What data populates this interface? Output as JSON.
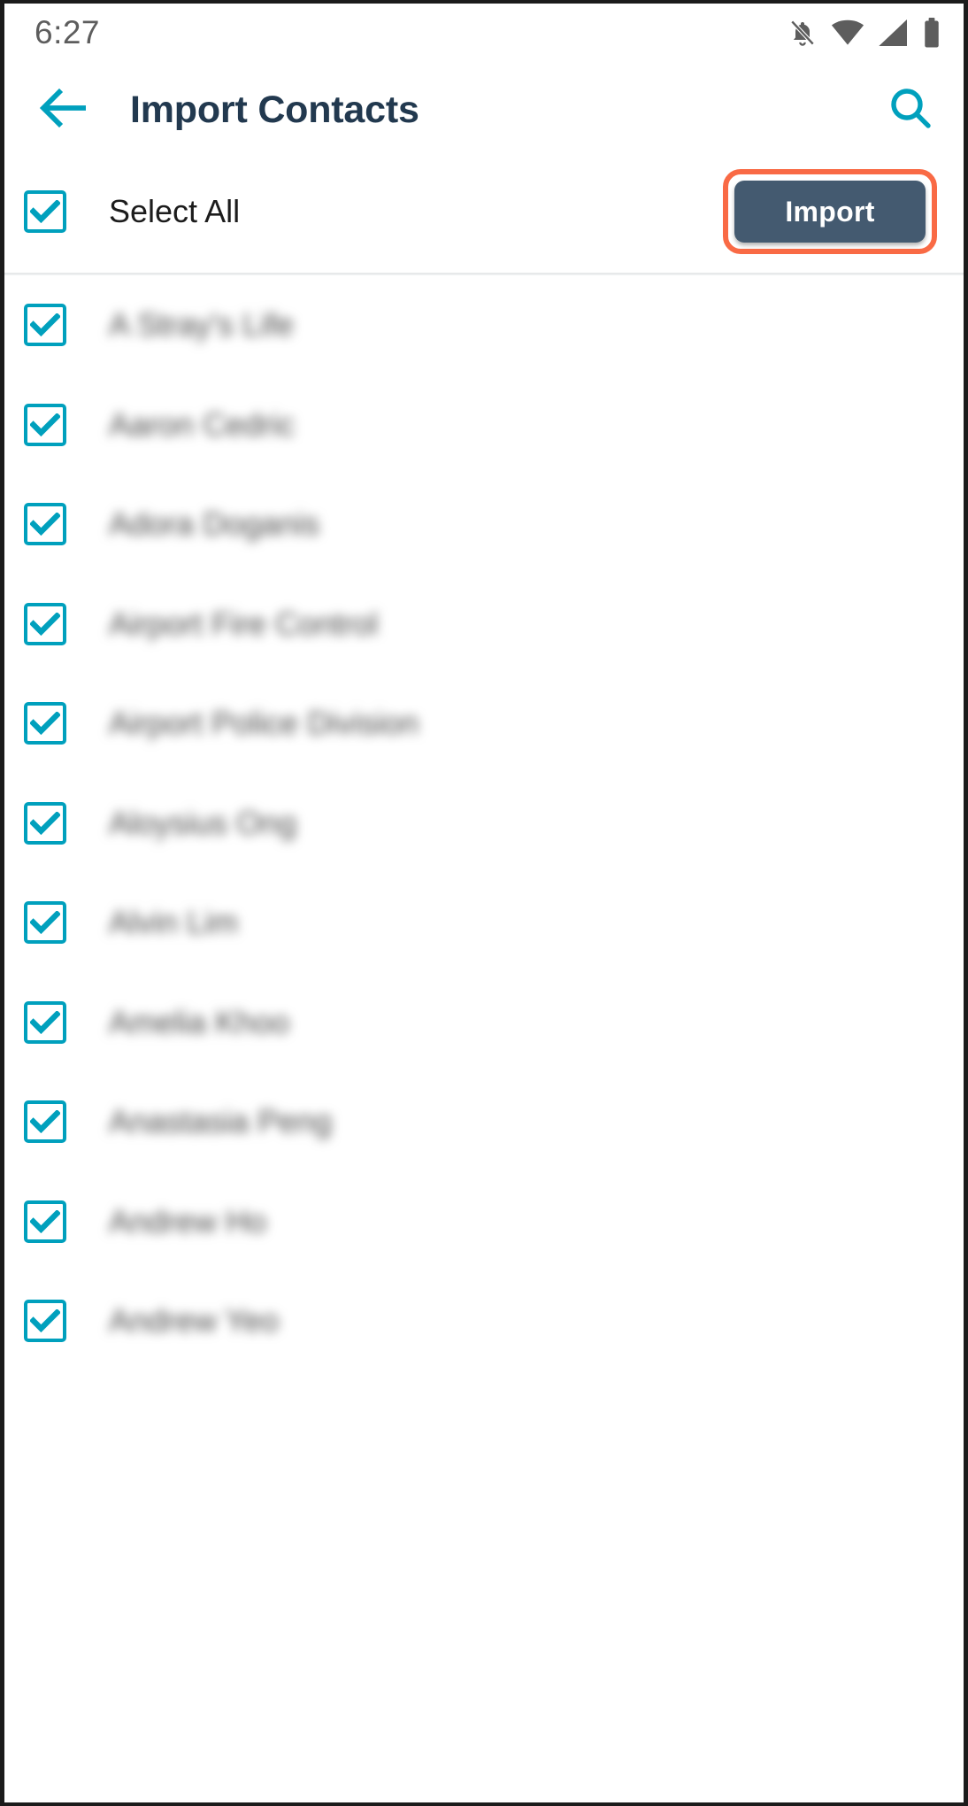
{
  "status_bar": {
    "time": "6:27",
    "icons": [
      "notifications-off-icon",
      "wifi-icon",
      "signal-icon",
      "battery-icon"
    ]
  },
  "app_bar": {
    "back_icon": "arrow-back-icon",
    "title": "Import Contacts",
    "search_icon": "search-icon"
  },
  "select_all_bar": {
    "checkbox_checked": true,
    "label": "Select All",
    "import_label": "Import",
    "import_highlighted": true
  },
  "colors": {
    "accent_teal": "#00a0bd",
    "title_navy": "#22394f",
    "button_bg": "#445a70",
    "highlight_ring": "#f96a45",
    "status_icon": "#5d5d5d",
    "contact_text": "#4a4a4a"
  },
  "contacts": [
    {
      "name": "A Stray's Life",
      "checked": true
    },
    {
      "name": "Aaron Cedric",
      "checked": true
    },
    {
      "name": "Adora Doganis",
      "checked": true
    },
    {
      "name": "Airport Fire Control",
      "checked": true
    },
    {
      "name": "Airport Police Division",
      "checked": true
    },
    {
      "name": "Aloysius Ong",
      "checked": true
    },
    {
      "name": "Alvin Lim",
      "checked": true
    },
    {
      "name": "Amelia Khoo",
      "checked": true
    },
    {
      "name": "Anastasia Peng",
      "checked": true
    },
    {
      "name": "Andrew Ho",
      "checked": true
    },
    {
      "name": "Andrew Yeo",
      "checked": true
    }
  ]
}
